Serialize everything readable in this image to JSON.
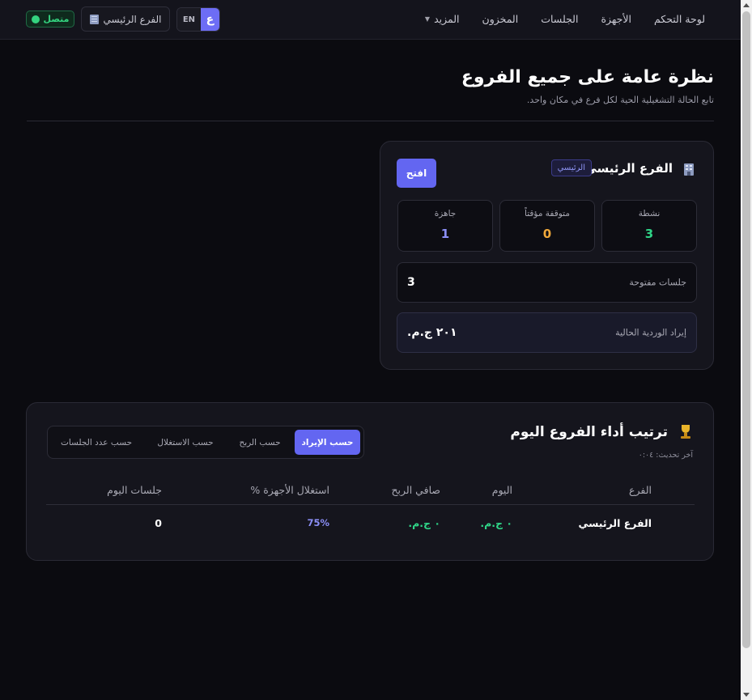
{
  "nav": {
    "links": [
      "لوحة التحكم",
      "الأجهزة",
      "الجلسات",
      "المخزون"
    ],
    "more_label": "المزيد",
    "lang_en": "EN",
    "lang_ar": "ع",
    "branch_selector": "الفرع الرئيسي",
    "status": "متصل"
  },
  "header": {
    "title": "نظرة عامة على جميع الفروع",
    "subtitle": "تابع الحالة التشغيلية الحية لكل فرع في مكان واحد."
  },
  "branch_card": {
    "name": "الفرع الرئيسي",
    "badge": "الرئيسي",
    "open_button": "افتح",
    "stats": [
      {
        "label": "نشطة",
        "value": "3",
        "color": "#2fd487"
      },
      {
        "label": "متوقفة مؤقتاً",
        "value": "0",
        "color": "#f0a83a"
      },
      {
        "label": "جاهزة",
        "value": "1",
        "color": "#8b8ff7"
      }
    ],
    "open_sessions_label": "جلسات مفتوحة",
    "open_sessions_value": "3",
    "shift_revenue_label": "إيراد الوردية الحالية",
    "shift_revenue_value": "٢٠١ ج.م."
  },
  "ranking": {
    "title": "ترتيب أداء الفروع اليوم",
    "last_updated": "آخر تحديث: ٠:٠٤",
    "tabs": [
      "حسب الإيراد",
      "حسب الربح",
      "حسب الاستغلال",
      "حسب عدد الجلسات"
    ],
    "active_tab": 0,
    "columns": [
      "الفرع",
      "اليوم",
      "صافي الربح",
      "استغلال الأجهزة %",
      "جلسات اليوم"
    ],
    "rows": [
      {
        "branch": "الفرع الرئيسي",
        "today": "٠ ج.م.",
        "net_profit": "٠ ج.م.",
        "utilization": "75%",
        "sessions": "0"
      }
    ]
  },
  "colors": {
    "accent": "#6366f1",
    "positive": "#2fd487",
    "warning": "#f0a83a",
    "background": "#0b0b10",
    "card": "#15151d"
  }
}
